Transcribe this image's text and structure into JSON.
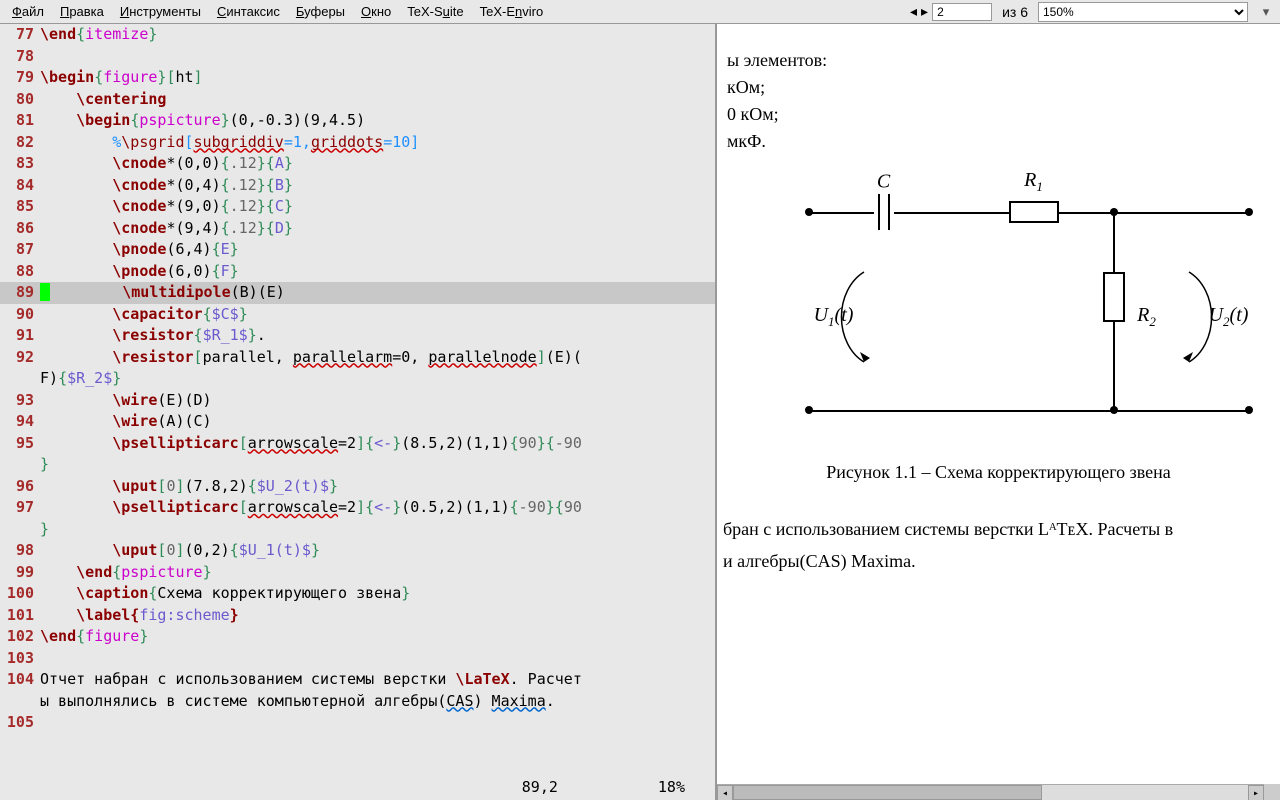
{
  "menubar": {
    "items": [
      {
        "u": "Ф",
        "rest": "айл"
      },
      {
        "u": "П",
        "rest": "равка"
      },
      {
        "u": "И",
        "rest": "нструменты"
      },
      {
        "u": "С",
        "rest": "интаксис"
      },
      {
        "u": "Б",
        "rest": "уферы"
      },
      {
        "u": "О",
        "rest": "кно"
      },
      {
        "pre": "TeX-S",
        "u": "u",
        "rest": "ite"
      },
      {
        "pre": "TeX-E",
        "u": "n",
        "rest": "viro"
      }
    ],
    "page_value": "2",
    "page_of": "из 6",
    "zoom": "150%"
  },
  "status": {
    "pos": "89,2",
    "pct": "18%"
  },
  "pdf": {
    "top_lines": [
      "ы элементов:",
      " кОм;",
      "0 кОм;",
      "мкФ."
    ],
    "labels": {
      "C": "C",
      "R1": "R",
      "R1sub": "1",
      "R2": "R",
      "R2sub": "2",
      "U1": "U",
      "U1sub": "1",
      "U2": "U",
      "U2sub": "2",
      "t": "(t)"
    },
    "caption": "Рисунок 1.1 – Схема корректирующего звена",
    "body1": "бран с использованием системы верстки LᴬTᴇX. Расчеты в",
    "body2": "и алгебры(CAS) Maxima."
  },
  "lines": [
    {
      "n": "77",
      "html": "<span class='kw'>\\end</span><span class='brkt'>{</span><span class='env'>itemize</span><span class='brkt'>}</span>"
    },
    {
      "n": "78",
      "html": ""
    },
    {
      "n": "79",
      "html": "<span class='kw'>\\begin</span><span class='brkt'>{</span><span class='env'>figure</span><span class='brkt'>}</span><span class='brkt'>[</span>ht<span class='brkt'>]</span>"
    },
    {
      "n": "80",
      "html": "    <span class='kw'>\\centering</span>"
    },
    {
      "n": "81",
      "html": "    <span class='kw'>\\begin</span><span class='brkt'>{</span><span class='env'>pspicture</span><span class='brkt'>}</span>(0,-0.3)(9,4.5)"
    },
    {
      "n": "82",
      "html": "        <span class='cmt'>%</span><span class='cmtkw'>\\psgrid</span><span class='cmt'>[</span><span class='cmtkw underline-wave'>subgriddiv</span><span class='cmt'>=1,</span><span class='cmtkw underline-wave'>griddots</span><span class='cmt'>=10]</span>"
    },
    {
      "n": "83",
      "html": "        <span class='kw'>\\cnode</span>*(0,0)<span class='brkt'>{</span><span class='param'>.12</span><span class='brkt'>}{</span><span class='math'>A</span><span class='brkt'>}</span>"
    },
    {
      "n": "84",
      "html": "        <span class='kw'>\\cnode</span>*(0,4)<span class='brkt'>{</span><span class='param'>.12</span><span class='brkt'>}{</span><span class='math'>B</span><span class='brkt'>}</span>"
    },
    {
      "n": "85",
      "html": "        <span class='kw'>\\cnode</span>*(9,0)<span class='brkt'>{</span><span class='param'>.12</span><span class='brkt'>}{</span><span class='math'>C</span><span class='brkt'>}</span>"
    },
    {
      "n": "86",
      "html": "        <span class='kw'>\\cnode</span>*(9,4)<span class='brkt'>{</span><span class='param'>.12</span><span class='brkt'>}{</span><span class='math'>D</span><span class='brkt'>}</span>"
    },
    {
      "n": "87",
      "html": "        <span class='kw'>\\pnode</span>(6,4)<span class='brkt'>{</span><span class='math'>E</span><span class='brkt'>}</span>"
    },
    {
      "n": "88",
      "html": "        <span class='kw'>\\pnode</span>(6,0)<span class='brkt'>{</span><span class='math'>F</span><span class='brkt'>}</span>"
    },
    {
      "n": "89",
      "html": "        <span class='kw'>\\multidipole</span>(B)(E)",
      "hl": true,
      "cursor": true
    },
    {
      "n": "90",
      "html": "        <span class='kw'>\\capacitor</span><span class='brkt'>{</span><span class='math'>$C$</span><span class='brkt'>}</span>"
    },
    {
      "n": "91",
      "html": "        <span class='kw'>\\resistor</span><span class='brkt'>{</span><span class='math'>$R_1$</span><span class='brkt'>}</span>."
    },
    {
      "n": "92",
      "html": "        <span class='kw'>\\resistor</span><span class='brkt'>[</span>parallel, <span class='underline-wave'>parallelarm</span>=0, <span class='underline-wave'>parallelnode</span><span class='brkt'>]</span>(E)("
    },
    {
      "n": "",
      "html": "F)<span class='brkt'>{</span><span class='math'>$R_2$</span><span class='brkt'>}</span>"
    },
    {
      "n": "93",
      "html": "        <span class='kw'>\\wire</span>(E)(D)"
    },
    {
      "n": "94",
      "html": "        <span class='kw'>\\wire</span>(A)(C)"
    },
    {
      "n": "95",
      "html": "        <span class='kw'>\\psellipticarc</span><span class='brkt'>[</span><span class='underline-wave'>arrowscale</span>=2<span class='brkt'>]{</span><span class='math'>&lt;-</span><span class='brkt'>}</span>(8.5,2)(1,1)<span class='brkt'>{</span><span class='param'>90</span><span class='brkt'>}{</span><span class='param'>-90</span>"
    },
    {
      "n": "",
      "html": "<span class='brkt'>}</span>"
    },
    {
      "n": "96",
      "html": "        <span class='kw'>\\uput</span><span class='brkt'>[</span><span class='param'>0</span><span class='brkt'>]</span>(7.8,2)<span class='brkt'>{</span><span class='math'>$U_2(t)$</span><span class='brkt'>}</span>"
    },
    {
      "n": "97",
      "html": "        <span class='kw'>\\psellipticarc</span><span class='brkt'>[</span><span class='underline-wave'>arrowscale</span>=2<span class='brkt'>]{</span><span class='math'>&lt;-</span><span class='brkt'>}</span>(0.5,2)(1,1)<span class='brkt'>{</span><span class='param'>-90</span><span class='brkt'>}{</span><span class='param'>90</span>"
    },
    {
      "n": "",
      "html": "<span class='brkt'>}</span>"
    },
    {
      "n": "98",
      "html": "        <span class='kw'>\\uput</span><span class='brkt'>[</span><span class='param'>0</span><span class='brkt'>]</span>(0,2)<span class='brkt'>{</span><span class='math'>$U_1(t)$</span><span class='brkt'>}</span>"
    },
    {
      "n": "99",
      "html": "    <span class='kw'>\\end</span><span class='brkt'>{</span><span class='env'>pspicture</span><span class='brkt'>}</span>"
    },
    {
      "n": "100",
      "html": "    <span class='kw'>\\caption</span><span class='brkt'>{</span>Схема корректирующего звена<span class='brkt'>}</span>"
    },
    {
      "n": "101",
      "html": "    <span class='kw'>\\label{</span><span class='math'>fig:scheme</span><span class='kw'>}</span>"
    },
    {
      "n": "102",
      "html": "<span class='kw'>\\end</span><span class='brkt'>{</span><span class='env'>figure</span><span class='brkt'>}</span>"
    },
    {
      "n": "103",
      "html": ""
    },
    {
      "n": "104",
      "html": "Отчет набран с использованием системы верстки <span class='kw'>\\LaTeX</span>. Расчет"
    },
    {
      "n": "",
      "html": "ы выполнялись в системе компьютерной алгебры(<span class='underline-blue'>CAS</span>) <span class='underline-blue'>Maxima</span>."
    },
    {
      "n": "105",
      "html": ""
    }
  ]
}
